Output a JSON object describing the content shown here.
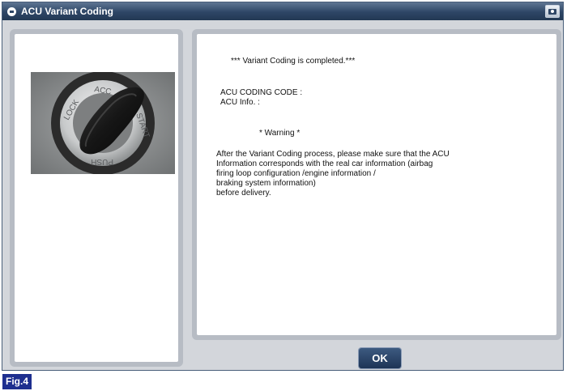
{
  "window": {
    "title": "ACU Variant Coding",
    "title_icon": "app-icon",
    "capture_icon": "camera-icon"
  },
  "image": {
    "description_icon": "ignition-key-photo",
    "engraved": [
      "LOCK",
      "ACC",
      "START",
      "PUSH"
    ]
  },
  "message": {
    "completed": "*** Variant Coding is completed.***",
    "coding_code_label": "ACU CODING CODE :",
    "info_label": "ACU Info. :",
    "warning_title": "* Warning *",
    "warning_lines": [
      "After the Variant Coding process, please make sure that the ACU",
      "Information corresponds with the real car information (airbag",
      "firing loop configuration /engine information /",
      "braking system information)",
      "before delivery."
    ]
  },
  "buttons": {
    "ok_label": "OK"
  },
  "figure": {
    "label": "Fig.4"
  },
  "colors": {
    "titlebar": "#2e4666",
    "ok_button": "#1d3456",
    "fig_label": "#1e2f8f",
    "panel_frame": "#b7bcc4"
  }
}
